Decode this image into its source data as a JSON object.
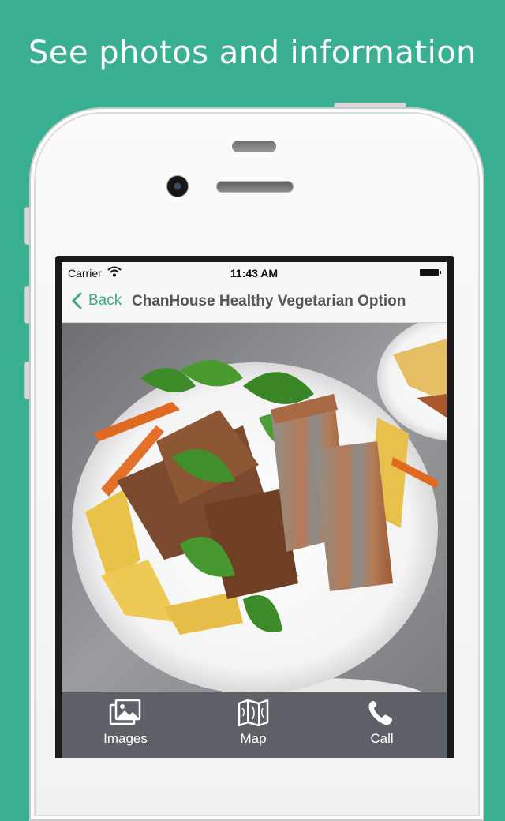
{
  "promo": {
    "headline": "See photos and information"
  },
  "status_bar": {
    "carrier": "Carrier",
    "time": "11:43 AM"
  },
  "nav_bar": {
    "back_label": "Back",
    "title": "ChanHouse Healthy Vegetarian Option"
  },
  "tab_bar": {
    "items": [
      {
        "label": "Images",
        "icon": "images-icon"
      },
      {
        "label": "Map",
        "icon": "map-icon"
      },
      {
        "label": "Call",
        "icon": "phone-icon"
      }
    ]
  },
  "colors": {
    "background": "#39b092",
    "accent": "#3aa98c",
    "tab_bar": "#5b6166"
  }
}
